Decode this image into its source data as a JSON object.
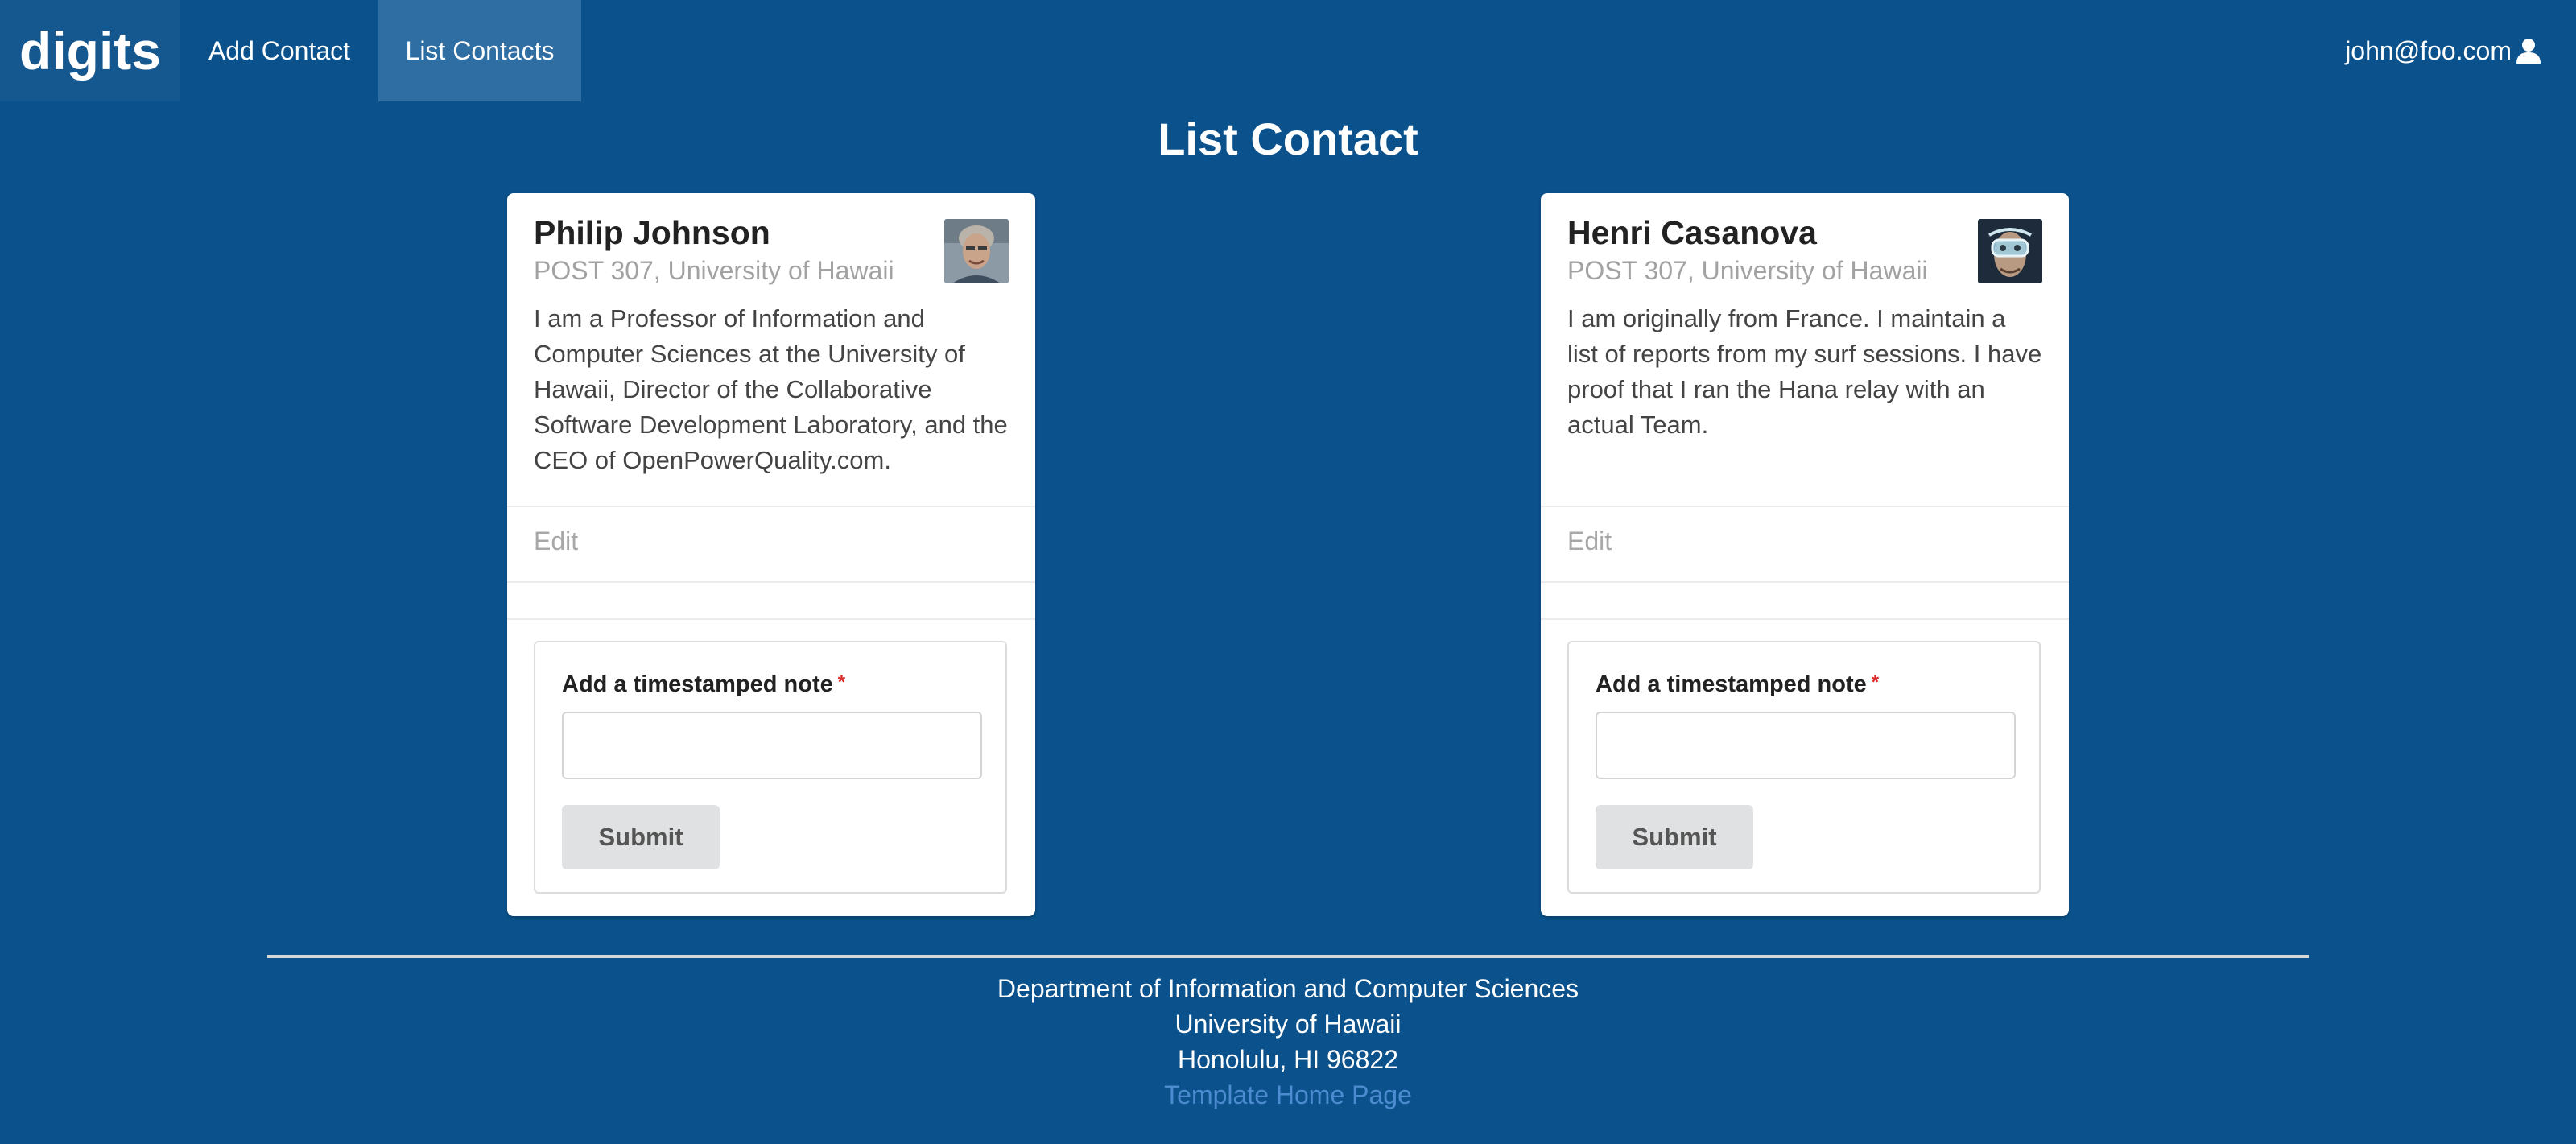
{
  "nav": {
    "brand": "digits",
    "add_contact": "Add Contact",
    "list_contacts": "List Contacts",
    "user_email": "john@foo.com",
    "user_icon": "user-icon"
  },
  "page_title": "List Contact",
  "contacts": [
    {
      "name": "Philip Johnson",
      "address": "POST 307, University of Hawaii",
      "description": "I am a Professor of Information and Computer Sciences at the University of Hawaii, Director of the Collaborative Software Development Laboratory, and the CEO of OpenPowerQuality.com.",
      "edit_label": "Edit",
      "note_label": "Add a timestamped note",
      "note_required_mark": "*",
      "note_value": "",
      "submit_label": "Submit"
    },
    {
      "name": "Henri Casanova",
      "address": "POST 307, University of Hawaii",
      "description": "I am originally from France. I maintain a list of reports from my surf sessions. I have proof that I ran the Hana relay with an actual Team.",
      "edit_label": "Edit",
      "note_label": "Add a timestamped note",
      "note_required_mark": "*",
      "note_value": "",
      "submit_label": "Submit"
    }
  ],
  "footer": {
    "line1": "Department of Information and Computer Sciences",
    "line2": "University of Hawaii",
    "line3": "Honolulu, HI 96822",
    "link": "Template Home Page"
  },
  "colors": {
    "background": "#0b528c",
    "active_nav": "#2f6ea3",
    "footer_link": "#4c8bd0"
  }
}
